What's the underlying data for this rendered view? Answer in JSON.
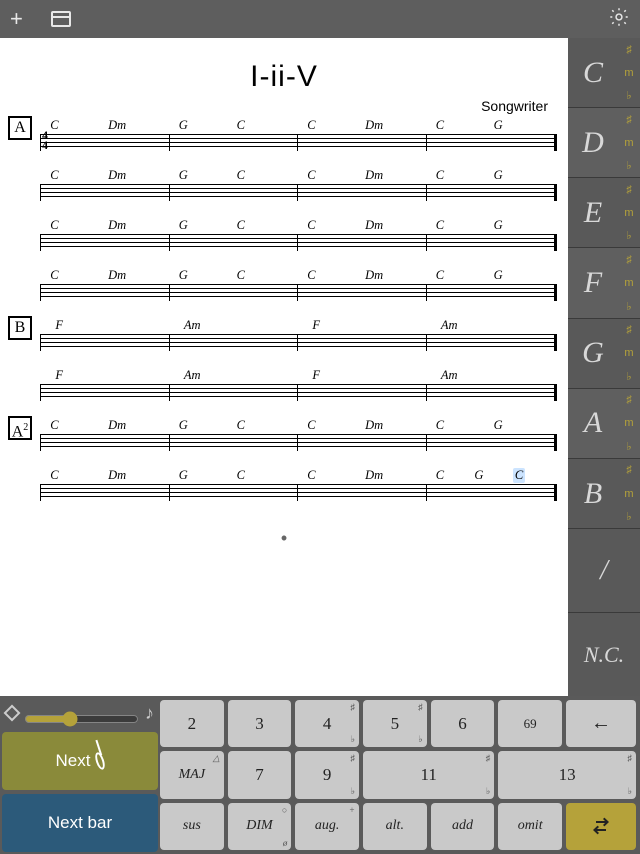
{
  "topbar": {
    "add_tip": "Add",
    "files_tip": "Files",
    "settings_tip": "Settings"
  },
  "sheet": {
    "title": "I-ii-V",
    "composer": "Songwriter",
    "time_sig_top": "4",
    "time_sig_bot": "4",
    "sections": [
      {
        "label": "A",
        "show_timesig": true,
        "lines": [
          {
            "bars": 4,
            "chords": [
              [
                "C",
                "Dm"
              ],
              [
                "G",
                "C"
              ],
              [
                "C",
                "Dm"
              ],
              [
                "C",
                "G"
              ]
            ]
          },
          {
            "bars": 4,
            "chords": [
              [
                "C",
                "Dm"
              ],
              [
                "G",
                "C"
              ],
              [
                "C",
                "Dm"
              ],
              [
                "C",
                "G"
              ]
            ]
          },
          {
            "bars": 4,
            "chords": [
              [
                "C",
                "Dm"
              ],
              [
                "G",
                "C"
              ],
              [
                "C",
                "Dm"
              ],
              [
                "C",
                "G"
              ]
            ]
          },
          {
            "bars": 4,
            "chords": [
              [
                "C",
                "Dm"
              ],
              [
                "G",
                "C"
              ],
              [
                "C",
                "Dm"
              ],
              [
                "C",
                "G"
              ]
            ]
          }
        ]
      },
      {
        "label": "B",
        "lines": [
          {
            "bars": 4,
            "chords": [
              [
                "F"
              ],
              [
                "Am"
              ],
              [
                "F"
              ],
              [
                "Am"
              ]
            ]
          },
          {
            "bars": 4,
            "chords": [
              [
                "F"
              ],
              [
                "Am"
              ],
              [
                "F"
              ],
              [
                "Am"
              ]
            ]
          }
        ]
      },
      {
        "label": "A²",
        "lines": [
          {
            "bars": 4,
            "chords": [
              [
                "C",
                "Dm"
              ],
              [
                "G",
                "C"
              ],
              [
                "C",
                "Dm"
              ],
              [
                "C",
                "G"
              ]
            ]
          },
          {
            "bars": 4,
            "chords": [
              [
                "C",
                "Dm"
              ],
              [
                "G",
                "C"
              ],
              [
                "C",
                "Dm"
              ],
              [
                "C",
                "G",
                "C"
              ]
            ],
            "last_selected": true
          }
        ]
      }
    ]
  },
  "palette": {
    "keys": [
      "C",
      "D",
      "E",
      "F",
      "G",
      "A",
      "B"
    ],
    "mods": [
      "♯",
      "m",
      "♭"
    ],
    "slash": "/",
    "nc": "N.C."
  },
  "keyboard": {
    "next": "Next",
    "next_bar": "Next bar",
    "row1": [
      {
        "l": "2"
      },
      {
        "l": "3"
      },
      {
        "l": "4",
        "sup": "♯",
        "sub": "♭"
      },
      {
        "l": "5",
        "sup": "♯",
        "sub": "♭"
      },
      {
        "l": "6"
      },
      {
        "l": "6⁄9",
        "frac": true
      },
      {
        "l": "←",
        "cls": "back"
      }
    ],
    "row2": [
      {
        "l": "MAJ",
        "cls": "small",
        "sup": "△"
      },
      {
        "l": "7"
      },
      {
        "l": "9",
        "sup": "♯",
        "sub": "♭"
      },
      {
        "l": "11",
        "sup": "♯",
        "sub": "♭"
      },
      {
        "l": "13",
        "sup": "♯",
        "sub": "♭"
      }
    ],
    "row3": [
      {
        "l": "sus",
        "cls": "small"
      },
      {
        "l": "DIM",
        "cls": "small",
        "sup": "○",
        "sub": "ø"
      },
      {
        "l": "aug.",
        "cls": "small",
        "sup": "+"
      },
      {
        "l": "alt.",
        "cls": "small"
      },
      {
        "l": "add",
        "cls": "small"
      },
      {
        "l": "omit",
        "cls": "small"
      },
      {
        "l": "",
        "cls": "swap"
      }
    ]
  }
}
